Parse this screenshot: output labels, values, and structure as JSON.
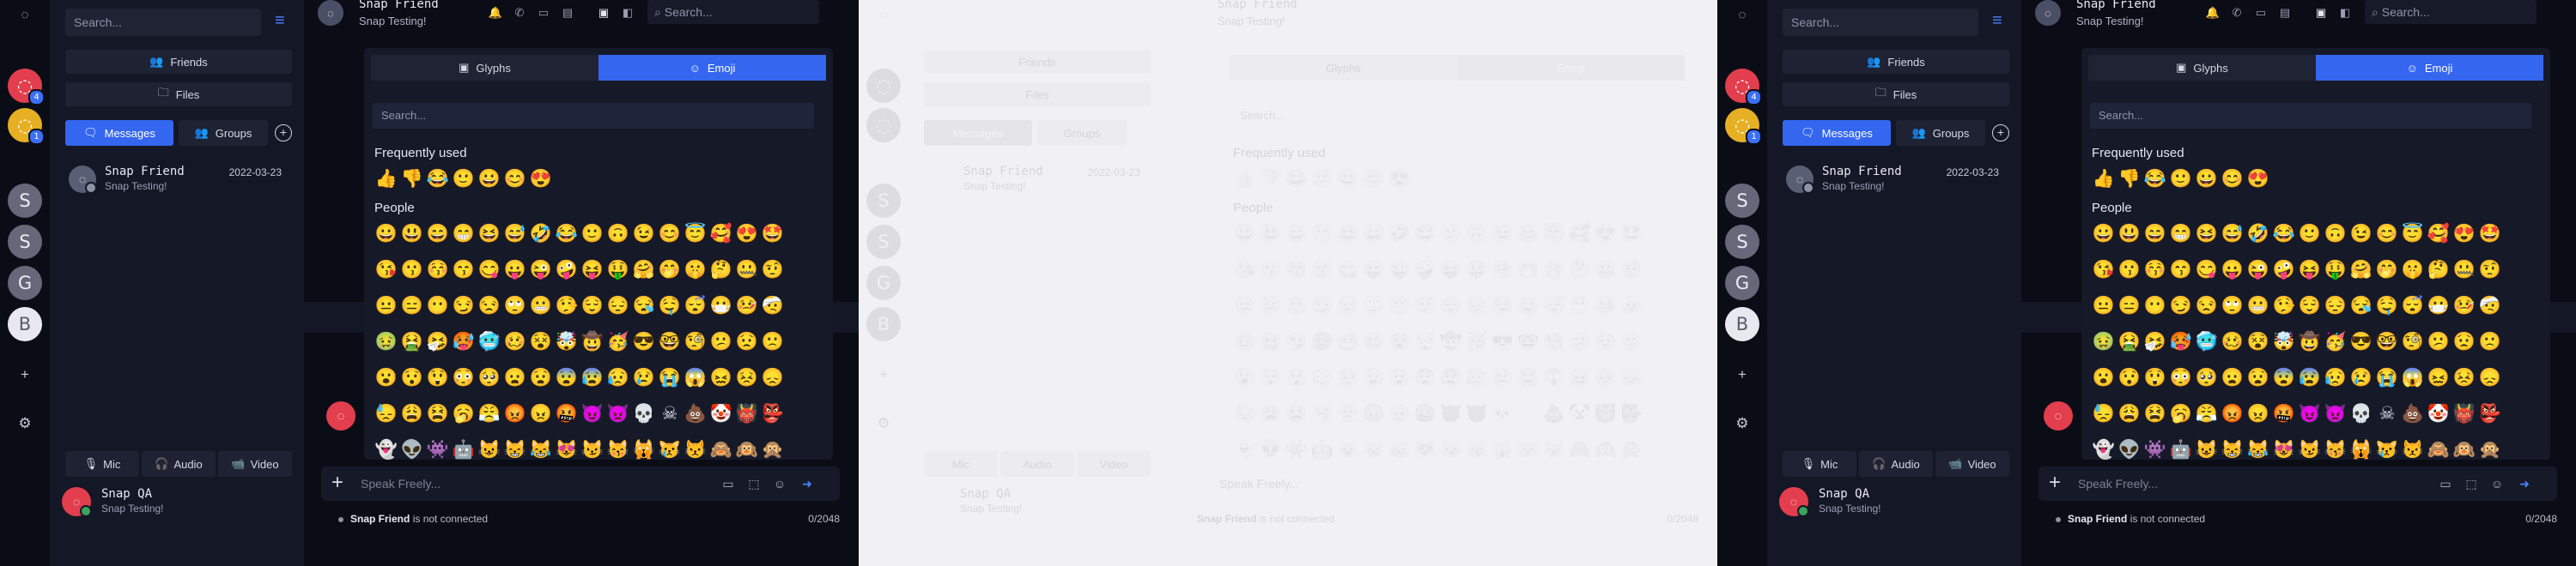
{
  "rail": {
    "avatars": [
      {
        "letter": "◌",
        "badge": "4"
      },
      {
        "letter": "◌",
        "badge": "1"
      },
      {
        "letter": "S"
      },
      {
        "letter": "S"
      },
      {
        "letter": "G"
      },
      {
        "letter": "B"
      }
    ],
    "add_icon": "+",
    "settings_icon": "⚙"
  },
  "sidebar": {
    "search_placeholder": "Search...",
    "friends_label": "Friends",
    "files_label": "Files",
    "messages_label": "Messages",
    "groups_label": "Groups",
    "chat": {
      "name": "Snap Friend",
      "sub": "Snap Testing!",
      "date": "2022-03-23"
    },
    "controls": {
      "mic": "Mic",
      "audio": "Audio",
      "video": "Video"
    },
    "user": {
      "name": "Snap QA",
      "sub": "Snap Testing!"
    }
  },
  "header": {
    "name": "Snap Friend",
    "sub": "Snap Testing!",
    "search_placeholder": "Search..."
  },
  "picker": {
    "tab_glyphs": "Glyphs",
    "tab_emoji": "Emoji",
    "search_placeholder": "Search...",
    "frequently_used_label": "Frequently used",
    "people_label": "People",
    "frequent": [
      "👍",
      "👎",
      "😂",
      "🙂",
      "😀",
      "😊",
      "😍"
    ],
    "people_rows": [
      [
        "😀",
        "😃",
        "😄",
        "😁",
        "😆",
        "😅",
        "🤣",
        "😂",
        "🙂",
        "🙃",
        "😉",
        "😊",
        "😇",
        "🥰",
        "😍",
        "🤩"
      ],
      [
        "😘",
        "😗",
        "😚",
        "😙",
        "😋",
        "😛",
        "😜",
        "🤪",
        "😝",
        "🤑",
        "🤗",
        "🤭",
        "🤫",
        "🤔",
        "🤐",
        "🤨"
      ],
      [
        "😐",
        "😑",
        "😶",
        "😏",
        "😒",
        "🙄",
        "😬",
        "🤥",
        "😌",
        "😔",
        "😪",
        "🤤",
        "😴",
        "😷",
        "🤒",
        "🤕"
      ],
      [
        "🤢",
        "🤮",
        "🤧",
        "🥵",
        "🥶",
        "🥴",
        "😵",
        "🤯",
        "🤠",
        "🥳",
        "😎",
        "🤓",
        "🧐",
        "😕",
        "😟",
        "🙁"
      ],
      [
        "😮",
        "😯",
        "😲",
        "😳",
        "🥺",
        "😦",
        "😧",
        "😨",
        "😰",
        "😥",
        "😢",
        "😭",
        "😱",
        "😖",
        "😣",
        "😞"
      ],
      [
        "😓",
        "😩",
        "😫",
        "🥱",
        "😤",
        "😡",
        "😠",
        "🤬",
        "😈",
        "👿",
        "💀",
        "☠",
        "💩",
        "🤡",
        "👹",
        "👺"
      ],
      [
        "👻",
        "👽",
        "👾",
        "🤖",
        "😺",
        "😸",
        "😹",
        "😻",
        "😼",
        "😽",
        "🙀",
        "😿",
        "😾",
        "🙈",
        "🙉",
        "🙊"
      ]
    ]
  },
  "composer": {
    "placeholder": "Speak Freely...",
    "status_name": "Snap Friend",
    "status_text": "is not connected",
    "counter": "0/2048"
  },
  "colors": {
    "accent": "#3466f0",
    "brand_red": "#e23e4e",
    "badge_blue": "#3b6ff5"
  }
}
